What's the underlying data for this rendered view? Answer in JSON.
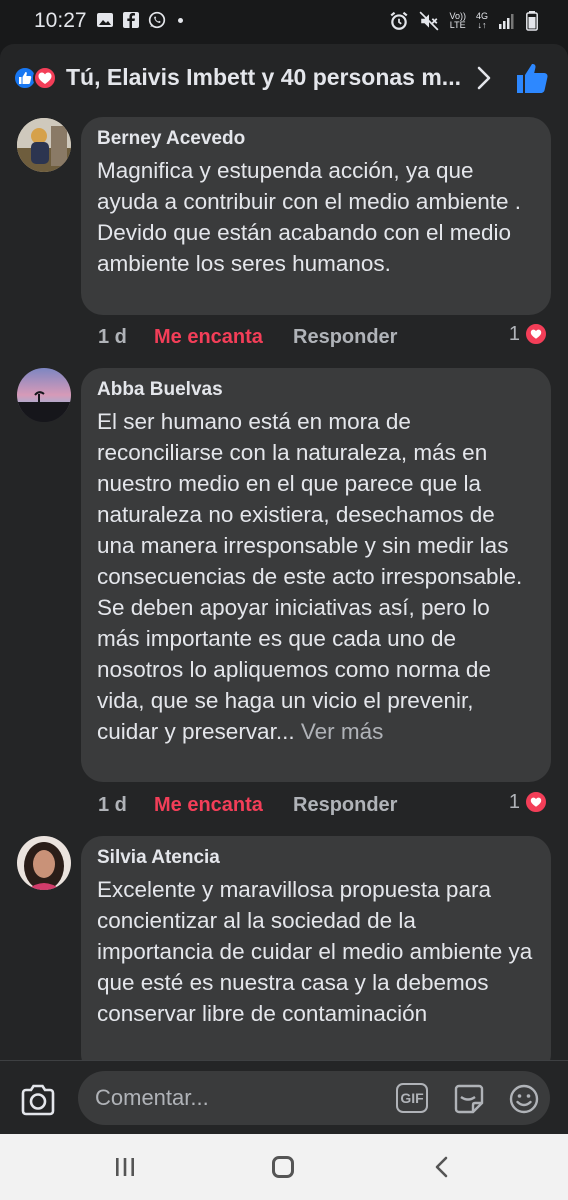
{
  "status_bar": {
    "time": "10:27",
    "network_top": "Vo))",
    "network_bottom": "LTE",
    "gen_top": "4G",
    "gen_bottom": "↓↑"
  },
  "header": {
    "title": "Tú, Elaivis Imbett y 40 personas m...",
    "reaction_icons": [
      "like-icon",
      "love-icon"
    ],
    "colors": {
      "like": "#1877f2",
      "love": "#f33e58"
    }
  },
  "comments": [
    {
      "author": "Berney Acevedo",
      "text": "Magnifica y estupenda acción, ya que ayuda a contribuir con el medio ambiente . Devido que están acabando con el medio ambiente los seres humanos.",
      "time": "1 d",
      "reaction_label": "Me encanta",
      "reply_label": "Responder",
      "reaction_count": "1"
    },
    {
      "author": "Abba Buelvas",
      "text": "El ser humano está en mora de reconciliarse con la naturaleza, más en nuestro medio en el que parece que la naturaleza no existiera, desechamos de una manera irresponsable y sin medir las consecuencias de este acto irresponsable. Se deben apoyar iniciativas así, pero lo más importante es que cada uno de nosotros lo apliquemos como norma de vida, que se haga un vicio el prevenir, cuidar y preservar...",
      "see_more": "Ver más",
      "time": "1 d",
      "reaction_label": "Me encanta",
      "reply_label": "Responder",
      "reaction_count": "1"
    },
    {
      "author": "Silvia Atencia",
      "text": "Excelente y maravillosa propuesta para concientizar al la sociedad de la importancia de cuidar el medio ambiente ya que esté es nuestra casa y la debemos conservar libre de contaminación"
    }
  ],
  "input": {
    "placeholder": "Comentar...",
    "gif_label": "GIF"
  }
}
